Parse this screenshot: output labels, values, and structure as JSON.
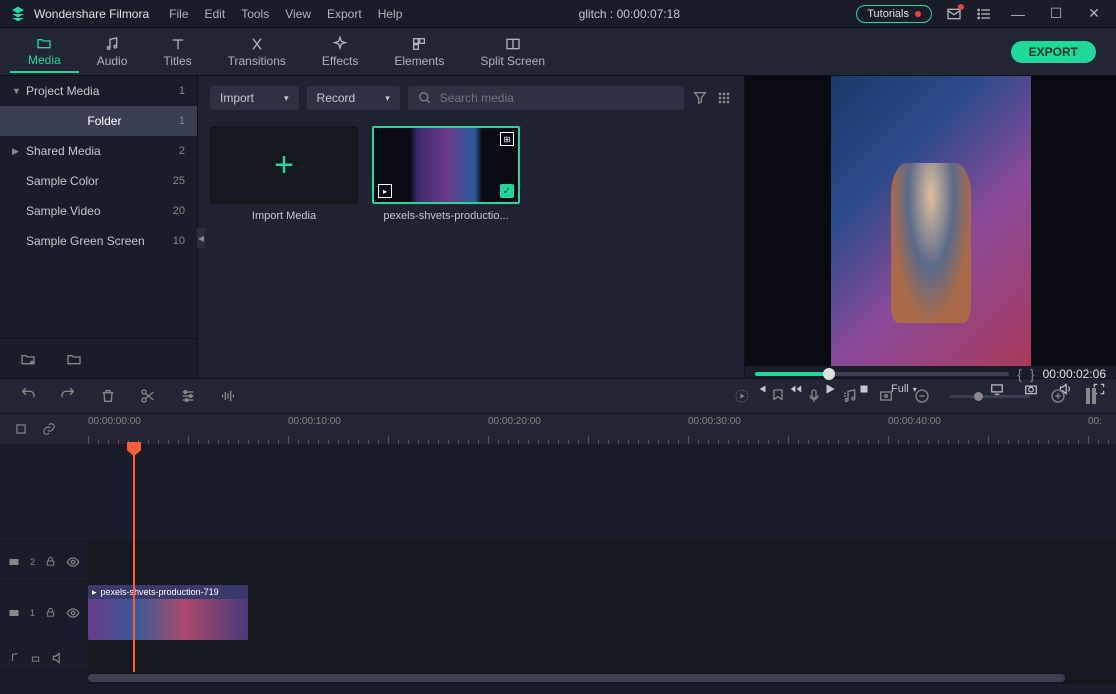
{
  "app": {
    "name": "Wondershare Filmora"
  },
  "menu": [
    "File",
    "Edit",
    "Tools",
    "View",
    "Export",
    "Help"
  ],
  "title_center": "glitch : 00:00:07:18",
  "tutorials_label": "Tutorials",
  "tabs": [
    {
      "label": "Media",
      "icon": "folder"
    },
    {
      "label": "Audio",
      "icon": "music"
    },
    {
      "label": "Titles",
      "icon": "text"
    },
    {
      "label": "Transitions",
      "icon": "transition"
    },
    {
      "label": "Effects",
      "icon": "sparkle"
    },
    {
      "label": "Elements",
      "icon": "elements"
    },
    {
      "label": "Split Screen",
      "icon": "split"
    }
  ],
  "export_label": "EXPORT",
  "sidebar": {
    "items": [
      {
        "label": "Project Media",
        "count": "1",
        "arrow": "▼"
      },
      {
        "label": "Folder",
        "count": "1",
        "active": true
      },
      {
        "label": "Shared Media",
        "count": "2",
        "arrow": "▶"
      },
      {
        "label": "Sample Color",
        "count": "25"
      },
      {
        "label": "Sample Video",
        "count": "20"
      },
      {
        "label": "Sample Green Screen",
        "count": "10"
      }
    ]
  },
  "media_top": {
    "import_label": "Import",
    "record_label": "Record",
    "search_placeholder": "Search media"
  },
  "media_items": {
    "import_card_label": "Import Media",
    "clip_label": "pexels-shvets-productio..."
  },
  "preview": {
    "time": "00:00:02:06",
    "full_label": "Full"
  },
  "timeline": {
    "ruler_labels": [
      "00:00:00:00",
      "00:00:10:00",
      "00:00:20:00",
      "00:00:30:00",
      "00:00:40:00",
      "00:"
    ],
    "track2_label": "2",
    "track1_label": "1",
    "clip_name": "pexels-shvets-production-719"
  }
}
